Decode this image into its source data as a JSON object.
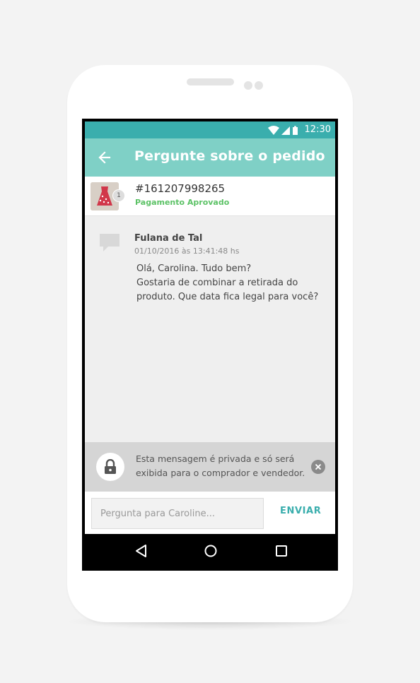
{
  "status_bar": {
    "time": "12:30"
  },
  "app_bar": {
    "title": "Pergunte sobre o pedido"
  },
  "order": {
    "number": "#161207998265",
    "status": "Pagamento Aprovado",
    "quantity": "1"
  },
  "message": {
    "sender": "Fulana de Tal",
    "timestamp": "01/10/2016 às 13:41:48 hs",
    "lines": [
      "Olá, Carolina. Tudo bem?",
      "Gostaria de combinar a retirada do",
      "produto. Que data fica legal para você?"
    ]
  },
  "notice": {
    "lines": [
      "Esta mensagem é privada e só será",
      "exibida para o comprador e vendedor."
    ]
  },
  "composer": {
    "placeholder": "Pergunta para Caroline...",
    "send_label": "ENVIAR"
  },
  "colors": {
    "status_bar": "#3aaead",
    "app_bar": "#7fd0c6",
    "accent": "#3aaead",
    "approved": "#5cc266"
  }
}
